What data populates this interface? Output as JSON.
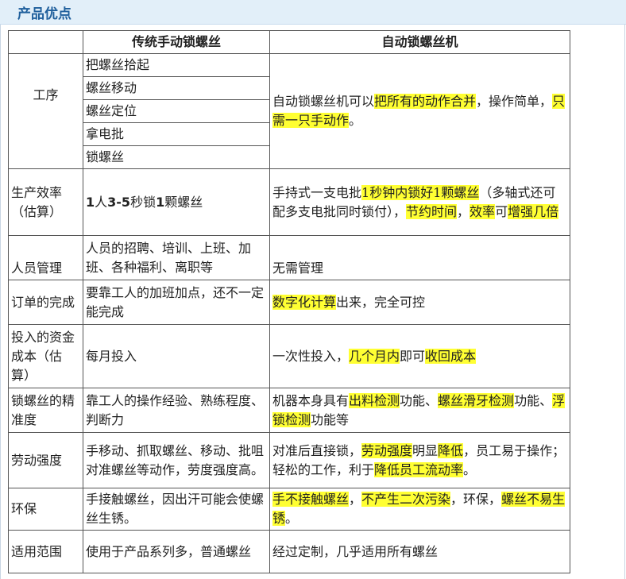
{
  "banner": {
    "title": "产品优点"
  },
  "table": {
    "headers": [
      "",
      "传统手动锁螺丝",
      "自动锁螺丝机"
    ],
    "process": {
      "label": "工序",
      "steps": [
        "把螺丝拾起",
        "螺丝移动",
        "螺丝定位",
        "拿电批",
        "锁螺丝"
      ],
      "auto": [
        "自动锁螺丝机可以",
        "把所有的动作合并",
        "，操作简单，",
        "只需一只手动作",
        "。"
      ]
    },
    "efficiency": {
      "label": "生产效率（估算）",
      "manual": [
        "1",
        "人",
        "3-5",
        "秒锁",
        "1",
        "颗螺丝"
      ],
      "auto": [
        "手持式一支电批",
        "1秒钟内锁好1颗螺丝",
        "（多轴式还可配多支电批同时锁付），",
        "节约时间",
        "，",
        "效率",
        "可",
        "增强几倍"
      ]
    },
    "staff": {
      "label": "人员管理",
      "manual": "人员的招聘、培训、上班、加班、各种福利、离职等",
      "auto": "无需管理"
    },
    "orders": {
      "label": "订单的完成",
      "manual": "要靠工人的加班加点，还不一定能完成",
      "auto": [
        "数字化计算",
        "出来，完全可控"
      ]
    },
    "cost": {
      "label": "投入的资金成本（估算）",
      "manual": "每月投入",
      "auto": [
        "一次性投入，",
        "几个月内",
        "即可",
        "收回成本"
      ]
    },
    "precision": {
      "label": "锁螺丝的精准度",
      "manual": "靠工人的操作经验、熟练程度、判断力",
      "auto": [
        "机器本身具有",
        "出料检测",
        "功能、",
        "螺丝滑牙检测",
        "功能、",
        "浮锁检测",
        "功能等"
      ]
    },
    "labor": {
      "label": "劳动强度",
      "manual": "手移动、抓取螺丝、移动、批咀对准螺丝等动作，劳度强度高。",
      "auto": [
        "对准后直接锁，",
        "劳动强度",
        "明显",
        "降低",
        "，员工易于操作；轻松的工作，利于",
        "降低员工流动率",
        "。"
      ]
    },
    "environment": {
      "label": "环保",
      "manual": "手接触螺丝，因出汗可能会使螺丝生锈。",
      "auto": [
        "手不接触螺丝",
        "，",
        "不产生二次污染",
        "，环保，",
        "螺丝不易生锈",
        "。"
      ]
    },
    "scope": {
      "label": "适用范围",
      "manual": "使用于产品系列多，普通螺丝",
      "auto": "经过定制，几乎适用所有螺丝"
    }
  },
  "colors": {
    "highlight": "#ffff33",
    "banner_bg": "#e2eff9",
    "banner_text": "#1f5f9c"
  }
}
